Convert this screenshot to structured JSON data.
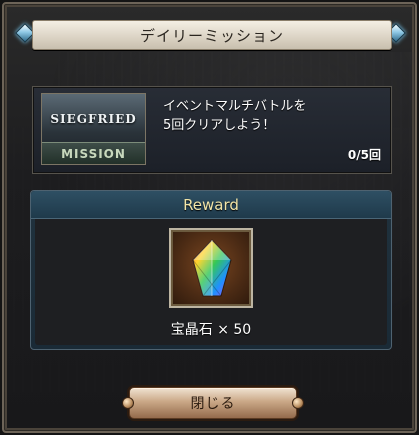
{
  "dialog": {
    "title": "デイリーミッション"
  },
  "mission": {
    "thumbnail_title": "SIEGFRIED",
    "thumbnail_badge": "MISSION",
    "description_line1": "イベントマルチバトルを",
    "description_line2": "5回クリアしよう！",
    "progress": "0/5回"
  },
  "reward": {
    "header": "Reward",
    "item_icon": "rainbow-crystal-icon",
    "item_label": "宝晶石 × 50"
  },
  "buttons": {
    "close_label": "閉じる"
  },
  "colors": {
    "frame": "#6d6458",
    "title_bar": "#e6dfd1",
    "reward_header": "#2e4f63",
    "reward_header_text": "#f1e5a8",
    "button": "#caa887"
  }
}
